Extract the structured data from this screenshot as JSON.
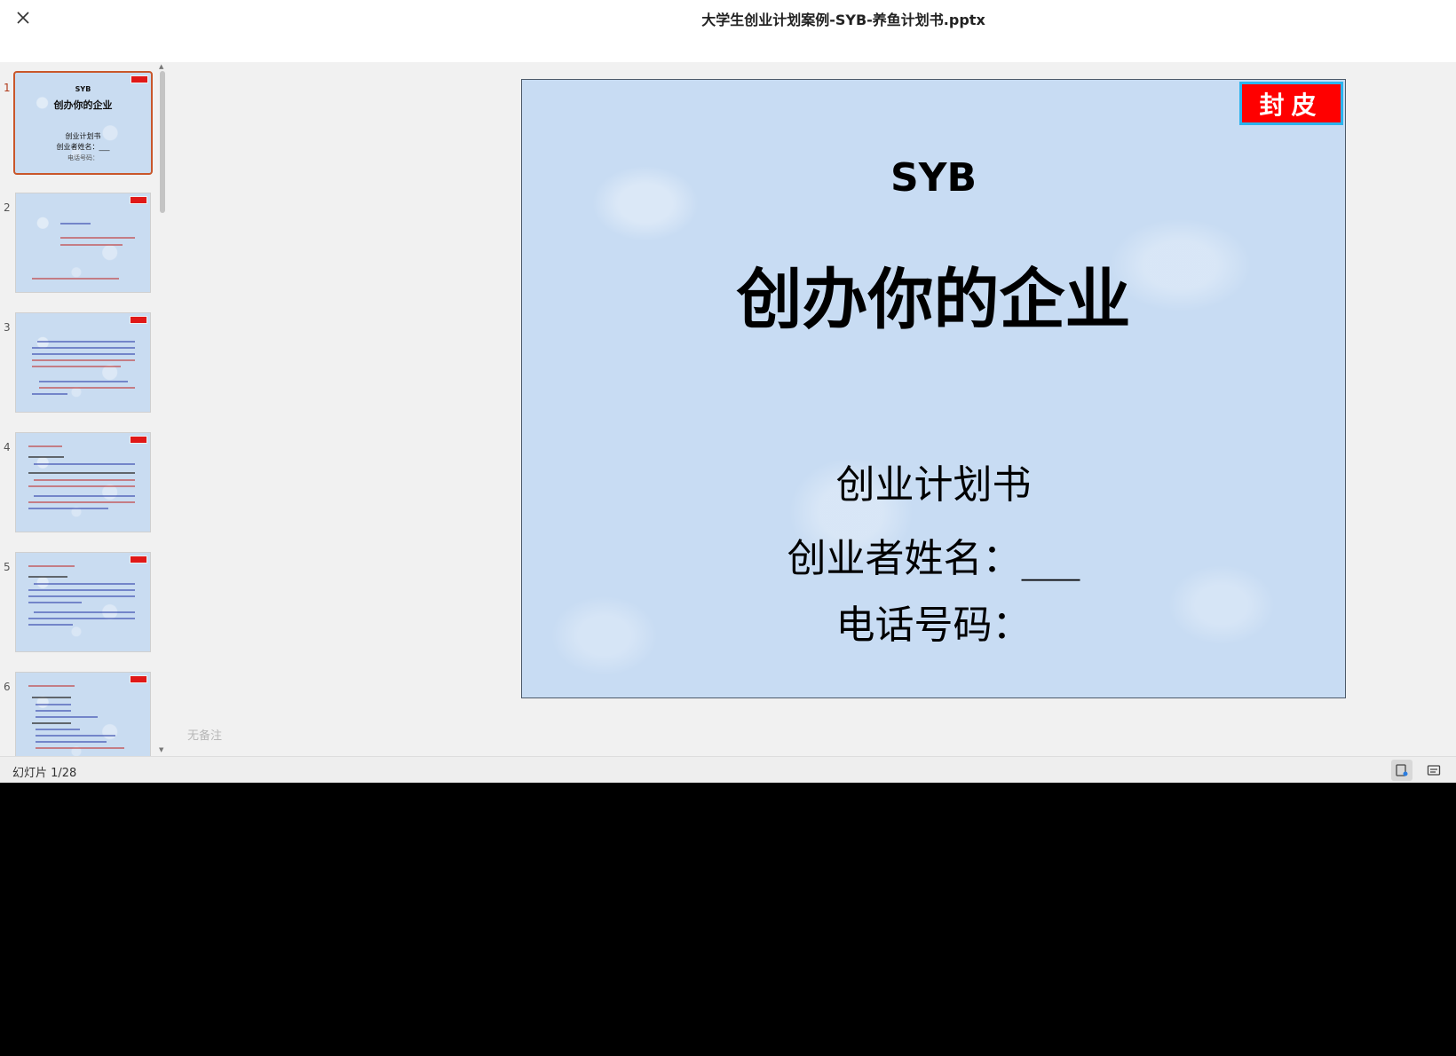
{
  "window": {
    "title": "大学生创业计划案例-SYB-养鱼计划书.pptx"
  },
  "thumbnails": [
    {
      "number": "1",
      "active": true
    },
    {
      "number": "2",
      "active": false
    },
    {
      "number": "3",
      "active": false
    },
    {
      "number": "4",
      "active": false
    },
    {
      "number": "5",
      "active": false
    },
    {
      "number": "6",
      "active": false
    }
  ],
  "thumb1": {
    "line1": "SYB",
    "line2": "创办你的企业",
    "line3": "创业计划书",
    "line4": "创业者姓名：___",
    "line5": "电话号码："
  },
  "slide": {
    "tag": "封皮",
    "heading": "SYB",
    "title": "创办你的企业",
    "subtitle": "创业计划书",
    "name_label": "创业者姓名：___",
    "phone_label": "电话号码："
  },
  "notes": {
    "placeholder": "无备注"
  },
  "status": {
    "slide_counter": "幻灯片 1/28"
  },
  "colors": {
    "accent": "#c9572b",
    "cover_tag": "#ff0000",
    "cover_tag_border": "#2ab4ee",
    "slide_bg": "#c8dcf3"
  }
}
